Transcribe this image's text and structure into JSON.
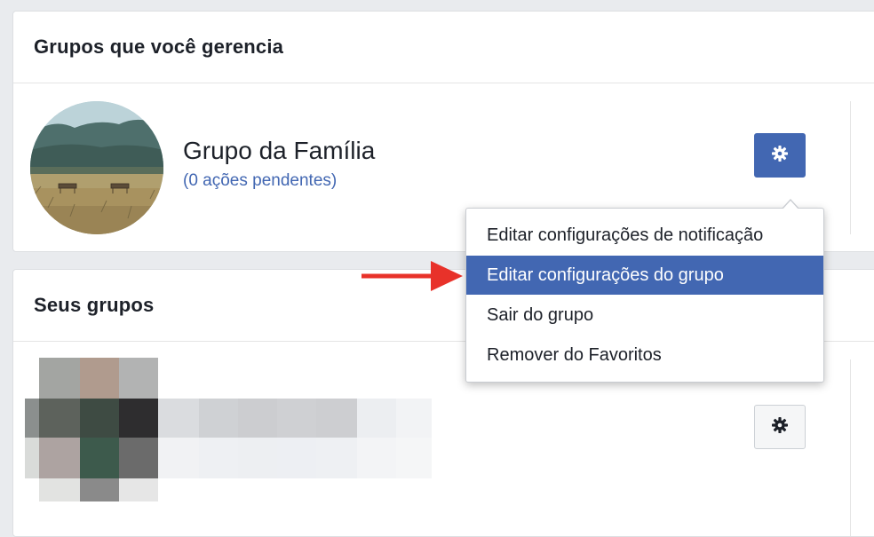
{
  "managed_section": {
    "title": "Grupos que você gerencia",
    "group": {
      "name": "Grupo da Família",
      "pending_actions": "(0 ações pendentes)"
    },
    "settings_icon": "gear-icon"
  },
  "dropdown_menu": {
    "items": [
      {
        "label": "Editar configurações de notificação",
        "selected": false
      },
      {
        "label": "Editar configurações do grupo",
        "selected": true
      },
      {
        "label": "Sair do grupo",
        "selected": false
      },
      {
        "label": "Remover do Favoritos",
        "selected": false
      }
    ]
  },
  "your_groups_section": {
    "title": "Seus grupos",
    "settings_icon": "gear-icon"
  },
  "colors": {
    "accent": "#4267b2",
    "page_background": "#e9ebee",
    "annotation_arrow": "#e8322a"
  }
}
